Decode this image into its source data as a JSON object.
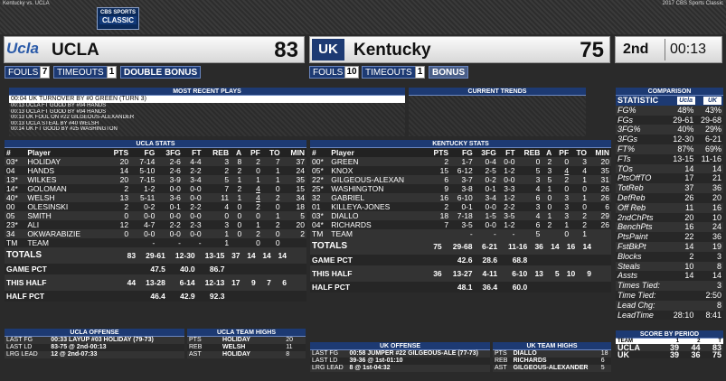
{
  "header": {
    "matchup": "Kentucky vs. UCLA",
    "copyright": "2017 CBS Sports Classic",
    "logo_top": "CBS SPORTS",
    "logo_bottom": "CLASSIC"
  },
  "away": {
    "logo": "Ucla",
    "name": "UCLA",
    "score": "83",
    "fouls_label": "FOULS",
    "fouls": "7",
    "timeouts_label": "TIMEOUTS",
    "timeouts": "1",
    "bonus": "DOUBLE BONUS"
  },
  "home": {
    "logo": "UK",
    "name": "Kentucky",
    "score": "75",
    "fouls_label": "FOULS",
    "fouls": "10",
    "timeouts_label": "TIMEOUTS",
    "timeouts": "1",
    "bonus": "BONUS"
  },
  "clock": {
    "period": "2nd",
    "time": "00:13"
  },
  "recent_plays": {
    "title": "MOST RECENT PLAYS",
    "items": [
      "00:04  UK TURNOVER BY #0 GREEN (TURN 3)",
      "00:13 UCLA FT GOOD BY #04 HANDS",
      "00:13 UCLA FT GOOD BY #04 HANDS",
      "00:13 UK FOUL ON #22 GILGEOUS-ALEXANDER",
      "00:13 UCLA STEAL BY #40 WELSH",
      "00:14 UK FT GOOD BY #25 WASHINGTON"
    ]
  },
  "trends": {
    "title": "CURRENT TRENDS"
  },
  "ucla_stats": {
    "title": "UCLA STATS",
    "headers": [
      "#",
      "Player",
      "PTS",
      "FG",
      "3FG",
      "FT",
      "REB",
      "A",
      "PF",
      "TO",
      "MIN"
    ],
    "rows": [
      [
        "03*",
        "HOLIDAY",
        "20",
        "7-14",
        "2-6",
        "4-4",
        "3",
        "8",
        "2",
        "7",
        "37"
      ],
      [
        "04",
        "HANDS",
        "14",
        "5-10",
        "2-6",
        "2-2",
        "2",
        "2",
        "0",
        "1",
        "24"
      ],
      [
        "13*",
        "WILKES",
        "20",
        "7-15",
        "3-9",
        "3-4",
        "5",
        "1",
        "1",
        "1",
        "35"
      ],
      [
        "14*",
        "GOLOMAN",
        "2",
        "1-2",
        "0-0",
        "0-0",
        "7",
        "2",
        "4",
        "0",
        "15"
      ],
      [
        "40*",
        "WELSH",
        "13",
        "5-11",
        "3-6",
        "0-0",
        "11",
        "1",
        "4",
        "2",
        "34"
      ],
      [
        "00",
        "OLESINSKI",
        "2",
        "0-2",
        "0-1",
        "2-2",
        "4",
        "0",
        "2",
        "0",
        "18"
      ],
      [
        "05",
        "SMITH",
        "0",
        "0-0",
        "0-0",
        "0-0",
        "0",
        "0",
        "0",
        "1",
        "5"
      ],
      [
        "23*",
        "ALI",
        "12",
        "4-7",
        "2-2",
        "2-3",
        "3",
        "0",
        "1",
        "2",
        "20"
      ],
      [
        "34",
        "OKWARABIZIE",
        "0",
        "0-0",
        "0-0",
        "0-0",
        "1",
        "0",
        "2",
        "0",
        "2"
      ],
      [
        "TM",
        "TEAM",
        "",
        "-",
        "-",
        "-",
        "1",
        "",
        "0",
        "0",
        ""
      ]
    ],
    "totals_label": "TOTALS",
    "totals": [
      "83",
      "29-61",
      "12-30",
      "13-15",
      "37",
      "14",
      "14",
      "14",
      ""
    ],
    "game_pct_label": "GAME PCT",
    "game_pct": [
      "47.5",
      "40.0",
      "86.7"
    ],
    "half_label": "THIS HALF",
    "half": [
      "44",
      "13-28",
      "6-14",
      "12-13",
      "17",
      "9",
      "7",
      "6",
      ""
    ],
    "half_pct_label": "HALF PCT",
    "half_pct": [
      "46.4",
      "42.9",
      "92.3"
    ]
  },
  "uk_stats": {
    "title": "KENTUCKY STATS",
    "headers": [
      "#",
      "Player",
      "PTS",
      "FG",
      "3FG",
      "FT",
      "REB",
      "A",
      "PF",
      "TO",
      "MIN"
    ],
    "rows": [
      [
        "00*",
        "GREEN",
        "2",
        "1-7",
        "0-4",
        "0-0",
        "0",
        "2",
        "0",
        "3",
        "20"
      ],
      [
        "05*",
        "KNOX",
        "15",
        "6-12",
        "2-5",
        "1-2",
        "5",
        "3",
        "4",
        "4",
        "35"
      ],
      [
        "22*",
        "GILGEOUS-ALEXAN",
        "6",
        "3-7",
        "0-2",
        "0-0",
        "3",
        "5",
        "2",
        "1",
        "31"
      ],
      [
        "25*",
        "WASHINGTON",
        "9",
        "3-8",
        "0-1",
        "3-3",
        "4",
        "1",
        "0",
        "0",
        "26"
      ],
      [
        "32",
        "GABRIEL",
        "16",
        "6-10",
        "3-4",
        "1-2",
        "6",
        "0",
        "3",
        "1",
        "26"
      ],
      [
        "01",
        "KILLEYA-JONES",
        "2",
        "0-1",
        "0-0",
        "2-2",
        "3",
        "0",
        "3",
        "0",
        "6"
      ],
      [
        "03*",
        "DIALLO",
        "18",
        "7-18",
        "1-5",
        "3-5",
        "4",
        "1",
        "3",
        "2",
        "29"
      ],
      [
        "04*",
        "RICHARDS",
        "7",
        "3-5",
        "0-0",
        "1-2",
        "6",
        "2",
        "1",
        "2",
        "26"
      ],
      [
        "TM",
        "TEAM",
        "",
        "-",
        "-",
        "-",
        "5",
        "",
        "0",
        "1",
        ""
      ]
    ],
    "totals_label": "TOTALS",
    "totals": [
      "75",
      "29-68",
      "6-21",
      "11-16",
      "36",
      "14",
      "16",
      "14",
      ""
    ],
    "game_pct_label": "GAME PCT",
    "game_pct": [
      "42.6",
      "28.6",
      "68.8"
    ],
    "half_label": "THIS HALF",
    "half": [
      "36",
      "13-27",
      "4-11",
      "6-10",
      "13",
      "5",
      "10",
      "9",
      ""
    ],
    "half_pct_label": "HALF PCT",
    "half_pct": [
      "48.1",
      "36.4",
      "60.0"
    ]
  },
  "ucla_offense": {
    "title": "UCLA OFFENSE",
    "rows": [
      [
        "LAST FG",
        "00:33 LAYUP #03 HOLIDAY (79-73)"
      ],
      [
        "LAST LD",
        "83-75 @ 2nd-00:13"
      ],
      [
        "LRG LEAD",
        "12 @ 2nd-07:33"
      ]
    ]
  },
  "ucla_highs": {
    "title": "UCLA TEAM HIGHS",
    "rows": [
      [
        "PTS",
        "HOLIDAY",
        "20"
      ],
      [
        "REB",
        "WELSH",
        "11"
      ],
      [
        "AST",
        "HOLIDAY",
        "8"
      ]
    ]
  },
  "uk_offense": {
    "title": "UK OFFENSE",
    "rows": [
      [
        "LAST FG",
        "00:58 JUMPER #22 GILGEOUS-ALE (77-73)"
      ],
      [
        "LAST LD",
        "39-36 @ 1st-01:10"
      ],
      [
        "LRG LEAD",
        "8 @ 1st-04:32"
      ]
    ]
  },
  "uk_highs": {
    "title": "UK TEAM HIGHS",
    "rows": [
      [
        "PTS",
        "DIALLO",
        "18"
      ],
      [
        "REB",
        "RICHARDS",
        "6"
      ],
      [
        "AST",
        "GILGEOUS-ALEXANDER",
        "5"
      ]
    ]
  },
  "comparison": {
    "title": "COMPARISON",
    "stat_label": "STATISTIC",
    "rows": [
      [
        "FG%",
        "48%",
        "43%"
      ],
      [
        "FGs",
        "29-61",
        "29-68"
      ],
      [
        "3FG%",
        "40%",
        "29%"
      ],
      [
        "3FGs",
        "12-30",
        "6-21"
      ],
      [
        "FT%",
        "87%",
        "69%"
      ],
      [
        "FTs",
        "13-15",
        "11-16"
      ],
      [
        "TOs",
        "14",
        "14"
      ],
      [
        "PtsOffTO",
        "17",
        "21"
      ],
      [
        "TotReb",
        "37",
        "36"
      ],
      [
        "DefReb",
        "26",
        "20"
      ],
      [
        "Off Reb",
        "11",
        "16"
      ],
      [
        "2ndChPts",
        "20",
        "10"
      ],
      [
        "BenchPts",
        "16",
        "24"
      ],
      [
        "PtsPaint",
        "22",
        "36"
      ],
      [
        "FstBkPt",
        "14",
        "19"
      ],
      [
        "Blocks",
        "2",
        "3"
      ],
      [
        "Steals",
        "10",
        "8"
      ],
      [
        "Assts",
        "14",
        "14"
      ]
    ],
    "extra": [
      [
        "Times Tied:",
        "",
        "3"
      ],
      [
        "Time Tied:",
        "",
        "2:50"
      ],
      [
        "Lead Chg:",
        "",
        "8"
      ],
      [
        "LeadTime",
        "28:10",
        "8:41"
      ]
    ]
  },
  "by_period": {
    "title": "SCORE BY PERIOD",
    "headers": [
      "TEAM",
      "1",
      "2",
      "T"
    ],
    "rows": [
      [
        "UCLA",
        "39",
        "44",
        "83"
      ],
      [
        "UK",
        "39",
        "36",
        "75"
      ]
    ]
  }
}
